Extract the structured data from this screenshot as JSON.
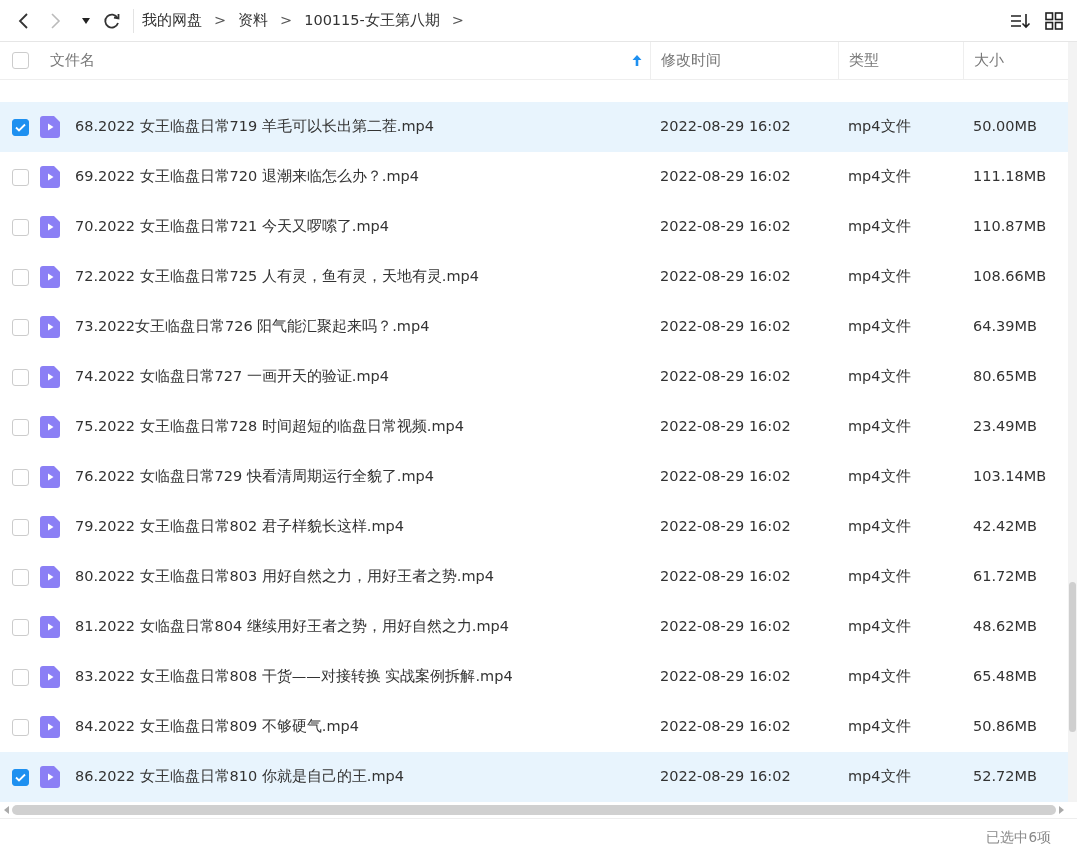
{
  "toolbar": {
    "breadcrumb": [
      {
        "label": "我的网盘"
      },
      {
        "label": "资料"
      },
      {
        "label": "100115-女王第八期"
      }
    ],
    "separator": ">"
  },
  "table": {
    "select_all": {
      "checked": false
    },
    "columns": [
      {
        "label": "文件名",
        "sorted": true
      },
      {
        "label": "修改时间",
        "sorted": false
      },
      {
        "label": "类型",
        "sorted": false
      },
      {
        "label": "大小",
        "sorted": false
      }
    ],
    "rows": [
      {
        "name": "68.2022 女王临盘日常719 羊毛可以长出第二茬.mp4",
        "modified": "2022-08-29 16:02",
        "type": "mp4文件",
        "size": "50.00MB",
        "selected": true
      },
      {
        "name": "69.2022 女王临盘日常720 退潮来临怎么办？.mp4",
        "modified": "2022-08-29 16:02",
        "type": "mp4文件",
        "size": "111.18MB",
        "selected": false
      },
      {
        "name": "70.2022 女王临盘日常721 今天又啰嗦了.mp4",
        "modified": "2022-08-29 16:02",
        "type": "mp4文件",
        "size": "110.87MB",
        "selected": false
      },
      {
        "name": "72.2022 女王临盘日常725 人有灵，鱼有灵，天地有灵.mp4",
        "modified": "2022-08-29 16:02",
        "type": "mp4文件",
        "size": "108.66MB",
        "selected": false
      },
      {
        "name": "73.2022女王临盘日常726 阳气能汇聚起来吗？.mp4",
        "modified": "2022-08-29 16:02",
        "type": "mp4文件",
        "size": "64.39MB",
        "selected": false
      },
      {
        "name": "74.2022 女临盘日常727 一画开天的验证.mp4",
        "modified": "2022-08-29 16:02",
        "type": "mp4文件",
        "size": "80.65MB",
        "selected": false
      },
      {
        "name": "75.2022 女王临盘日常728 时间超短的临盘日常视频.mp4",
        "modified": "2022-08-29 16:02",
        "type": "mp4文件",
        "size": "23.49MB",
        "selected": false
      },
      {
        "name": "76.2022 女临盘日常729 快看清周期运行全貌了.mp4",
        "modified": "2022-08-29 16:02",
        "type": "mp4文件",
        "size": "103.14MB",
        "selected": false
      },
      {
        "name": "79.2022 女王临盘日常802 君子样貌长这样.mp4",
        "modified": "2022-08-29 16:02",
        "type": "mp4文件",
        "size": "42.42MB",
        "selected": false
      },
      {
        "name": "80.2022 女王临盘日常803 用好自然之力，用好王者之势.mp4",
        "modified": "2022-08-29 16:02",
        "type": "mp4文件",
        "size": "61.72MB",
        "selected": false
      },
      {
        "name": "81.2022 女临盘日常804 继续用好王者之势，用好自然之力.mp4",
        "modified": "2022-08-29 16:02",
        "type": "mp4文件",
        "size": "48.62MB",
        "selected": false
      },
      {
        "name": "83.2022 女王临盘日常808 干货——对接转换 实战案例拆解.mp4",
        "modified": "2022-08-29 16:02",
        "type": "mp4文件",
        "size": "65.48MB",
        "selected": false
      },
      {
        "name": "84.2022 女王临盘日常809 不够硬气.mp4",
        "modified": "2022-08-29 16:02",
        "type": "mp4文件",
        "size": "50.86MB",
        "selected": false
      },
      {
        "name": "86.2022 女王临盘日常810 你就是自己的王.mp4",
        "modified": "2022-08-29 16:02",
        "type": "mp4文件",
        "size": "52.72MB",
        "selected": true
      }
    ]
  },
  "status_bar": {
    "text": "已选中6项"
  }
}
